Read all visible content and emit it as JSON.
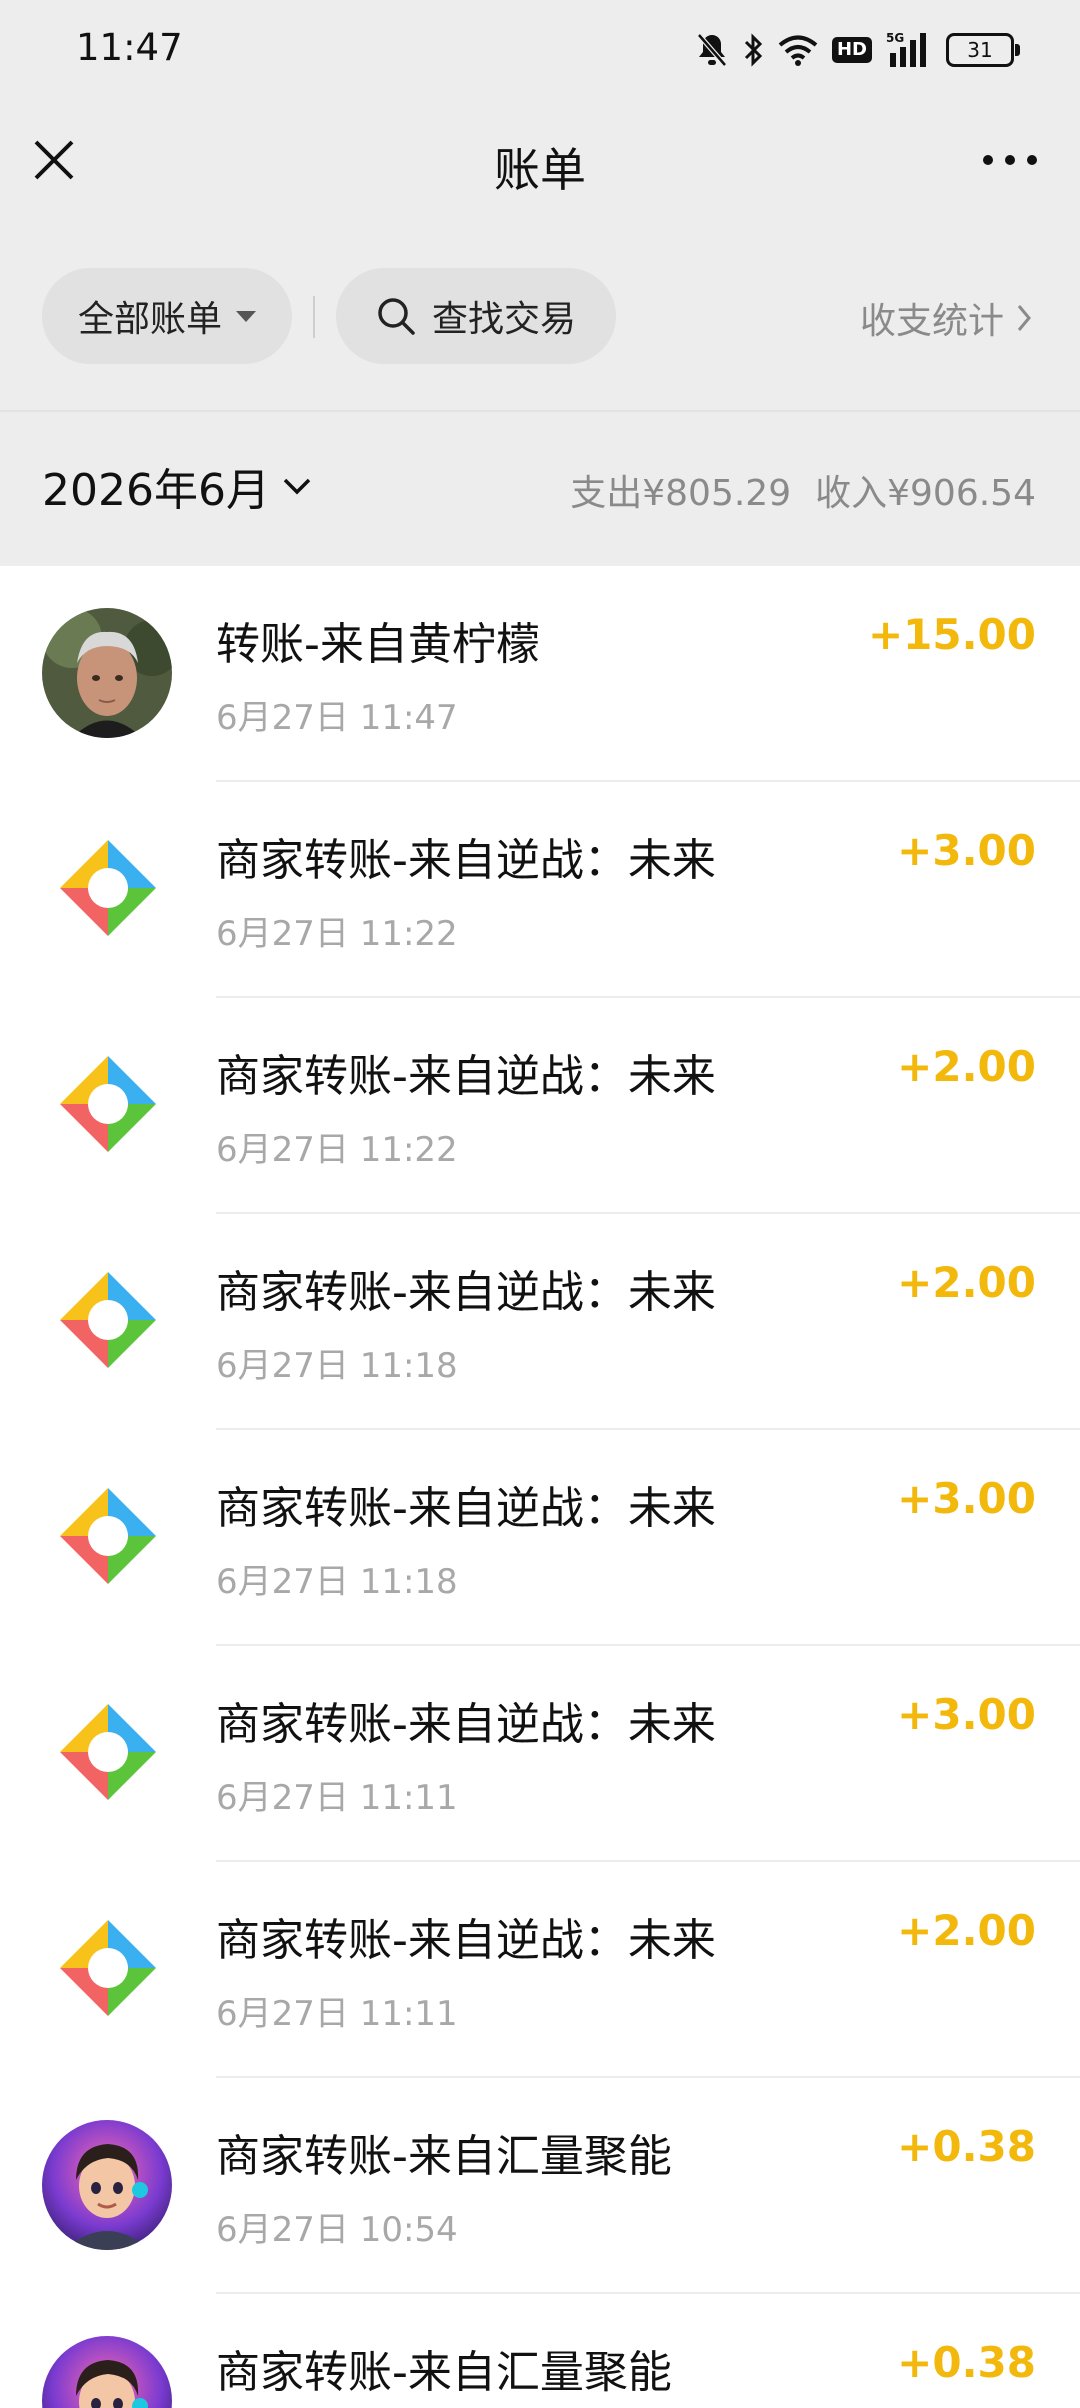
{
  "status_bar": {
    "time": "11:47",
    "network": "5G",
    "hd": "HD",
    "battery": "31",
    "icons": [
      "bell-muted-icon",
      "bluetooth-icon",
      "wifi-icon",
      "hd-icon",
      "signal-icon",
      "battery-icon"
    ]
  },
  "nav": {
    "title": "账单",
    "close_icon": "close-icon",
    "more_icon": "more-icon"
  },
  "filters": {
    "all_bills": "全部账单",
    "search": "查找交易",
    "stats": "收支统计"
  },
  "month": {
    "label": "2026年6月",
    "expense": "支出¥805.29",
    "income": "收入¥906.54"
  },
  "colors": {
    "amount": "#f2b80c",
    "background": "#ededed"
  },
  "transactions": [
    {
      "title": "转账-来自黄柠檬",
      "date": "6月27日 11:47",
      "amount": "+15.00",
      "icon": "person-avatar"
    },
    {
      "title": "商家转账-来自逆战：未来",
      "date": "6月27日 11:22",
      "amount": "+3.00",
      "icon": "merchant-logo"
    },
    {
      "title": "商家转账-来自逆战：未来",
      "date": "6月27日 11:22",
      "amount": "+2.00",
      "icon": "merchant-logo"
    },
    {
      "title": "商家转账-来自逆战：未来",
      "date": "6月27日 11:18",
      "amount": "+2.00",
      "icon": "merchant-logo"
    },
    {
      "title": "商家转账-来自逆战：未来",
      "date": "6月27日 11:18",
      "amount": "+3.00",
      "icon": "merchant-logo"
    },
    {
      "title": "商家转账-来自逆战：未来",
      "date": "6月27日 11:11",
      "amount": "+3.00",
      "icon": "merchant-logo"
    },
    {
      "title": "商家转账-来自逆战：未来",
      "date": "6月27日 11:11",
      "amount": "+2.00",
      "icon": "merchant-logo"
    },
    {
      "title": "商家转账-来自汇量聚能",
      "date": "6月27日 10:54",
      "amount": "+0.38",
      "icon": "cartoon-avatar"
    },
    {
      "title": "商家转账-来自汇量聚能",
      "date": "",
      "amount": "+0.38",
      "icon": "cartoon-avatar"
    }
  ]
}
